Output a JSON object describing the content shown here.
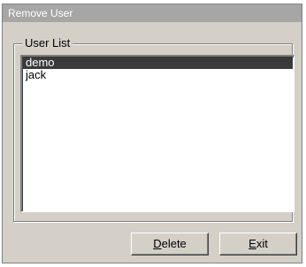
{
  "window": {
    "title": "Remove User"
  },
  "user_list": {
    "label": "User List",
    "items": [
      {
        "label": "demo",
        "selected": true
      },
      {
        "label": "jack",
        "selected": false
      }
    ]
  },
  "buttons": {
    "delete_label": "Delete",
    "exit_label": "Exit"
  }
}
